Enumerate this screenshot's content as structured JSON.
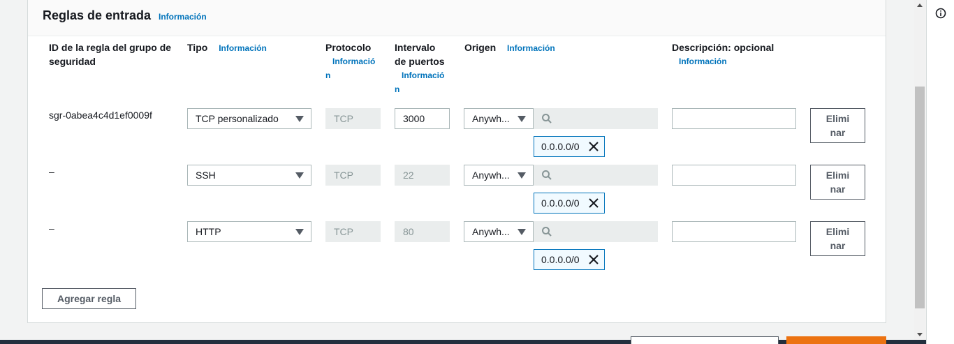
{
  "section": {
    "title": "Reglas de entrada",
    "info_link": "Información"
  },
  "columns": {
    "rule_id": {
      "line1": "ID de la regla del grupo de",
      "line2": "seguridad"
    },
    "type": {
      "label": "Tipo",
      "info": "Información"
    },
    "protocol": {
      "label": "Protocolo",
      "info_line1": "Informació",
      "info_line2": "n"
    },
    "port_range": {
      "line1": "Intervalo",
      "line2": "de puertos",
      "info_line1": "Informació",
      "info_line2": "n"
    },
    "source": {
      "label": "Origen",
      "info": "Información"
    },
    "description": {
      "label": "Descripción: opcional",
      "info": "Información"
    }
  },
  "rules": [
    {
      "rule_id": "sgr-0abea4c4d1ef0009f",
      "type": "TCP personalizado",
      "protocol": "TCP",
      "port_range": "3000",
      "source": "Anywh...",
      "cidr": "0.0.0.0/0",
      "description": "",
      "remove_line1": "Elimi",
      "remove_line2": "nar"
    },
    {
      "rule_id": "–",
      "type": "SSH",
      "protocol": "TCP",
      "port_range": "22",
      "source": "Anywh...",
      "cidr": "0.0.0.0/0",
      "description": "",
      "remove_line1": "Elimi",
      "remove_line2": "nar"
    },
    {
      "rule_id": "–",
      "type": "HTTP",
      "protocol": "TCP",
      "port_range": "80",
      "source": "Anywh...",
      "cidr": "0.0.0.0/0",
      "description": "",
      "remove_line1": "Elimi",
      "remove_line2": "nar"
    }
  ],
  "add_rule_button": "Agregar regla",
  "icons": {
    "dropdown": "caret-down-icon",
    "search": "search-icon",
    "remove_token": "close-icon",
    "help": "info-icon"
  },
  "colors": {
    "link": "#0073bb",
    "token_border": "#0073bb",
    "primary_button": "#ec7211",
    "footer": "#232f3e"
  }
}
